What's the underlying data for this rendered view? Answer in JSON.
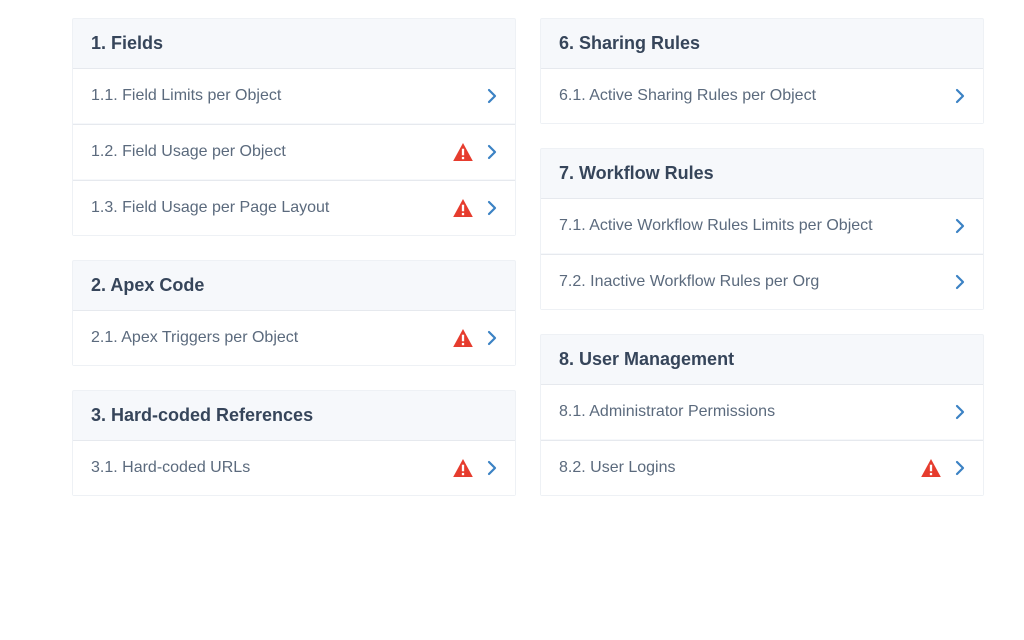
{
  "columns": [
    {
      "sections": [
        {
          "title": "1. Fields",
          "name": "section-fields",
          "items": [
            {
              "label": "1.1. Field Limits per Object",
              "warn": false,
              "name": "item-field-limits"
            },
            {
              "label": "1.2. Field Usage per Object",
              "warn": true,
              "name": "item-field-usage-object"
            },
            {
              "label": "1.3. Field Usage per Page Layout",
              "warn": true,
              "name": "item-field-usage-layout"
            }
          ]
        },
        {
          "title": "2. Apex Code",
          "name": "section-apex-code",
          "items": [
            {
              "label": "2.1. Apex Triggers per Object",
              "warn": true,
              "name": "item-apex-triggers"
            }
          ]
        },
        {
          "title": "3. Hard-coded References",
          "name": "section-hardcoded-references",
          "items": [
            {
              "label": "3.1. Hard-coded URLs",
              "warn": true,
              "name": "item-hardcoded-urls"
            }
          ]
        }
      ]
    },
    {
      "sections": [
        {
          "title": "6. Sharing Rules",
          "name": "section-sharing-rules",
          "items": [
            {
              "label": "6.1. Active Sharing Rules per Object",
              "warn": false,
              "name": "item-active-sharing-rules"
            }
          ]
        },
        {
          "title": "7. Workflow Rules",
          "name": "section-workflow-rules",
          "items": [
            {
              "label": "7.1. Active Workflow Rules Limits per Object",
              "warn": false,
              "name": "item-active-workflow-limits"
            },
            {
              "label": "7.2. Inactive Workflow Rules per Org",
              "warn": false,
              "name": "item-inactive-workflow-rules"
            }
          ]
        },
        {
          "title": "8. User Management",
          "name": "section-user-management",
          "items": [
            {
              "label": "8.1. Administrator Permissions",
              "warn": false,
              "name": "item-admin-permissions"
            },
            {
              "label": "8.2. User Logins",
              "warn": true,
              "name": "item-user-logins"
            }
          ]
        }
      ]
    }
  ]
}
